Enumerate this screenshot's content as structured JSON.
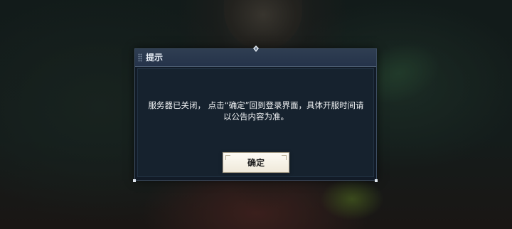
{
  "dialog": {
    "title": "提示",
    "message_line1": "服务器已关闭， 点击“确定”回到登录界面，具体开服时间请",
    "message_line2": "以公告内容为准。",
    "confirm_label": "确定"
  },
  "icons": {
    "grip": "grip-dots-icon",
    "ornament": "diamond-ornament-icon"
  },
  "colors": {
    "titlebar": "#2f3e52",
    "dialog_body": "#16222e",
    "button": "#f5f0e3"
  }
}
